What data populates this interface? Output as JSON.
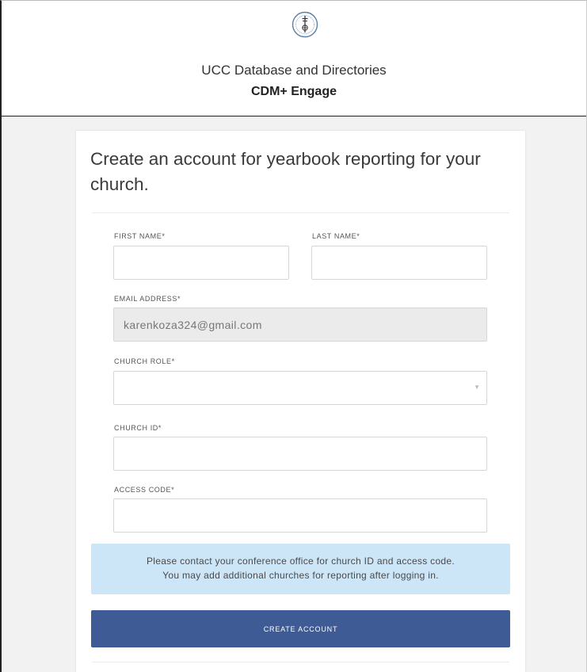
{
  "header": {
    "title": "UCC Database and Directories",
    "subtitle": "CDM+ Engage",
    "logo_icon": "ucc-seal-icon"
  },
  "form": {
    "heading": "Create an account for yearbook reporting for your church.",
    "first_name": {
      "label": "FIRST NAME*",
      "value": ""
    },
    "last_name": {
      "label": "LAST NAME*",
      "value": ""
    },
    "email": {
      "label": "EMAIL ADDRESS*",
      "value": "karenkoza324@gmail.com"
    },
    "church_role": {
      "label": "CHURCH ROLE*",
      "value": ""
    },
    "church_id": {
      "label": "CHURCH ID*",
      "value": ""
    },
    "access_code": {
      "label": "ACCESS CODE*",
      "value": ""
    },
    "info_line1": "Please contact your conference office for church ID and access code.",
    "info_line2": "You may add additional churches for reporting after logging in.",
    "submit_label": "CREATE ACCOUNT"
  },
  "colors": {
    "button": "#3e5b95",
    "info_background": "#cce5f7",
    "disabled_field": "#ebebeb"
  }
}
